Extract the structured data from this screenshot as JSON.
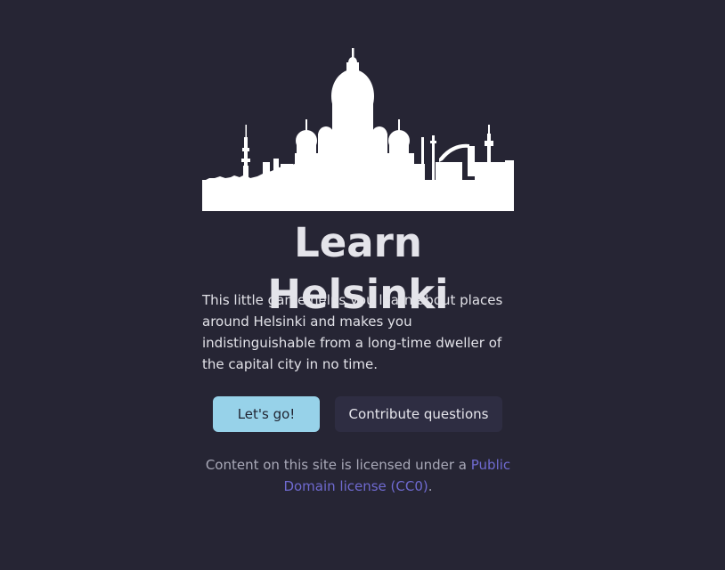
{
  "colors": {
    "background": "#262534",
    "primary_button": "#97d2e9",
    "secondary_button": "#2e2d42",
    "link": "#6f6ad0"
  },
  "hero": {
    "image_description": "white silhouette of the Helsinki skyline with the cathedral dome",
    "title": "Learn Helsinki",
    "intro": "This little game helps you learn about places around Helsinki and makes you indistinguishable from a long-time dweller of the capital city in no time."
  },
  "actions": {
    "start_label": "Let's go!",
    "contribute_label": "Contribute questions"
  },
  "footer": {
    "license_prefix": "Content on this site is licensed under a ",
    "license_link": "Public Domain license (CC0)",
    "license_suffix": "."
  }
}
